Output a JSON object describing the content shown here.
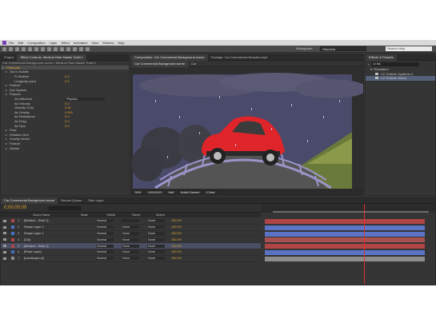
{
  "menu": {
    "items": [
      "File",
      "Edit",
      "Composition",
      "Layer",
      "Effect",
      "Animation",
      "View",
      "Window",
      "Help"
    ]
  },
  "toolbar": {
    "workspace_label": "Workspace:",
    "workspace_value": "Standard",
    "search_help_placeholder": "Search Help"
  },
  "effect_controls": {
    "tab_project": "Project",
    "tab_effect_controls": "Effect Controls: Medium Rain Master Solid 1",
    "header_line": "Car Commercial Background scene • Medium Rain Master Solid 1",
    "rows": [
      {
        "label": "Particular",
        "kind": "section"
      },
      {
        "label": "Out in Subtile",
        "kind": "item"
      },
      {
        "label": "Fx Bottom",
        "value": "0.0"
      },
      {
        "label": "Longevity (sec)",
        "value": "0.0"
      },
      {
        "label": "Particle",
        "kind": "item"
      },
      {
        "label": "Aux System",
        "kind": "item"
      },
      {
        "label": "Physics",
        "kind": "item"
      },
      {
        "label": "Air Influence",
        "dropdown": "Physics"
      },
      {
        "label": "Air Velocity",
        "value": "0.0"
      },
      {
        "label": "Velocity % Air",
        "value": "0.00"
      },
      {
        "label": "Air Gravity",
        "value": "0.000"
      },
      {
        "label": "Air Resistance",
        "value": "0.0"
      },
      {
        "label": "Air Drag",
        "value": "0.0"
      },
      {
        "label": "Air Spin",
        "value": "0.0"
      },
      {
        "label": "Flow",
        "kind": "item"
      },
      {
        "label": "Rotation Grid",
        "kind": "item"
      },
      {
        "label": "Gravity Vector",
        "kind": "item"
      },
      {
        "label": "Particle",
        "kind": "item"
      },
      {
        "label": "Global",
        "kind": "item"
      }
    ]
  },
  "composition": {
    "tab_composition": "Composition: Car Commercial Background scene",
    "tab_footage": "Footage: Car Commercial Branded.mp4",
    "sub_tab_1": "Car Commercial Background scene",
    "sub_tab_2": "Car",
    "viewbar": {
      "zoom": "50%",
      "timecode": "0;00;00;00",
      "resolution": "Half",
      "camera": "Active Camera",
      "views": "1 View"
    }
  },
  "effects_presets": {
    "tab": "Effects & Presets",
    "search_value": "cc bal",
    "items": [
      {
        "label": "Simulation",
        "kind": "folder"
      },
      {
        "label": "CC Particle Systems II",
        "kind": "item"
      },
      {
        "label": "CC Particle World",
        "kind": "item",
        "selected": true
      }
    ]
  },
  "timeline": {
    "tab_1": "Car Commercial Background scene",
    "tab_2": "Render Queue",
    "tab_3": "Rain Layer",
    "timecode": "0;00;00;00",
    "search_placeholder": "",
    "columns": {
      "source_name": "Source Name",
      "mode": "Mode",
      "trkmat": "TrkMat",
      "parent": "Parent",
      "stretch": "Stretch"
    },
    "layers": [
      {
        "num": "1",
        "name": "[Medium...Solid 1]",
        "mode": "Normal",
        "trk": "",
        "parent": "None",
        "stretch": "100.0%",
        "label_color": "#b04545",
        "bar_color": "#b04545"
      },
      {
        "num": "2",
        "name": "Shape Layer 2",
        "mode": "Normal",
        "trk": "None",
        "parent": "None",
        "stretch": "100.0%",
        "label_color": "#4a6fc0",
        "bar_color": "#5b74c6"
      },
      {
        "num": "3",
        "name": "Shape Layer 1",
        "mode": "Normal",
        "trk": "None",
        "parent": "None",
        "stretch": "100.0%",
        "label_color": "#4a6fc0",
        "bar_color": "#5b74c6"
      },
      {
        "num": "4",
        "name": "[Car]",
        "mode": "Normal",
        "trk": "None",
        "parent": "None",
        "stretch": "100.0%",
        "label_color": "#b04545",
        "bar_color": "#a65050"
      },
      {
        "num": "5",
        "name": "[Medium...Solid 1]",
        "mode": "Normal",
        "trk": "None",
        "parent": "None",
        "stretch": "100.0%",
        "label_color": "#b04545",
        "bar_color": "#b04545",
        "selected": true
      },
      {
        "num": "6",
        "name": "[Road Layer]",
        "mode": "Normal",
        "trk": "None",
        "parent": "None",
        "stretch": "100.0%",
        "label_color": "#4a6fc0",
        "bar_color": "#5b74c6"
      },
      {
        "num": "7",
        "name": "[Landscape.ai]",
        "mode": "Normal",
        "trk": "None",
        "parent": "None",
        "stretch": "100.0%",
        "label_color": "#8a8a8a",
        "bar_color": "#8c8c8c"
      }
    ],
    "playhead_fraction": 0.62
  },
  "colors": {
    "accent": "#e2a231",
    "sky": "#4a4a6a",
    "car_red": "#e0252a",
    "ground": "#545454",
    "fence": "#9a94c8"
  }
}
